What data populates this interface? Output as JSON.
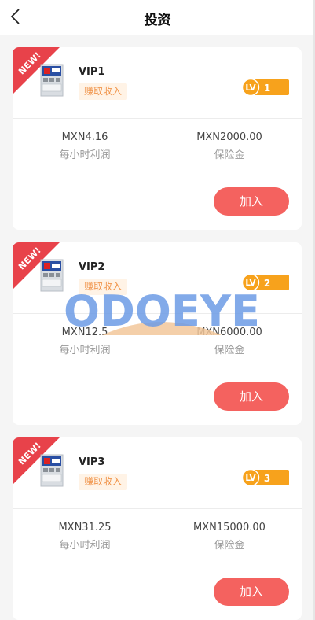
{
  "header": {
    "title": "投资"
  },
  "ribbon_text": "NEW!",
  "colors": {
    "button": "#f4625f",
    "lv_badge": "#f7a21c",
    "ribbon": "#e8424a",
    "tag_text": "#f0944a"
  },
  "cards": [
    {
      "name": "VIP1",
      "tag": "赚取收入",
      "lv_label": "LV",
      "level": "1",
      "hourly_profit": "MXN4.16",
      "hourly_profit_label": "每小时利润",
      "deposit": "MXN2000.00",
      "deposit_label": "保险金",
      "button": "加入"
    },
    {
      "name": "VIP2",
      "tag": "赚取收入",
      "lv_label": "LV",
      "level": "2",
      "hourly_profit": "MXN12.5",
      "hourly_profit_label": "每小时利润",
      "deposit": "MXN6000.00",
      "deposit_label": "保险金",
      "button": "加入"
    },
    {
      "name": "VIP3",
      "tag": "赚取收入",
      "lv_label": "LV",
      "level": "3",
      "hourly_profit": "MXN31.25",
      "hourly_profit_label": "每小时利润",
      "deposit": "MXN15000.00",
      "deposit_label": "保险金",
      "button": "加入"
    }
  ],
  "watermark": "ODOEYE"
}
